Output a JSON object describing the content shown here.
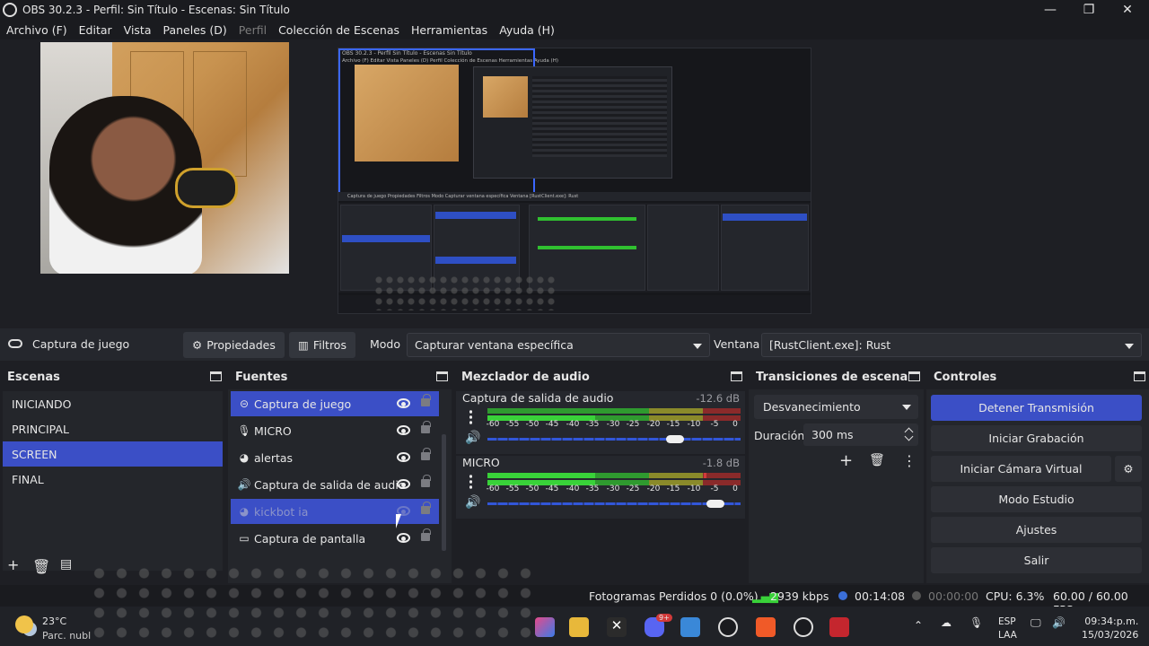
{
  "window": {
    "title": "OBS 30.2.3 - Perfil: Sin Título - Escenas: Sin Título",
    "minimize": "—",
    "maximize": "❐",
    "close": "✕"
  },
  "menu": [
    "Archivo (F)",
    "Editar",
    "Vista",
    "Paneles (D)",
    "Perfil",
    "Colección de Escenas",
    "Herramientas",
    "Ayuda (H)"
  ],
  "menu_disabled_index": 4,
  "nested_preview": {
    "title": "OBS 30.2.3 - Perfil Sin Título - Escenas Sin Título",
    "menu": "Archivo (F)   Editar   Vista   Paneles (D)   Perfil   Colección de Escenas   Herramientas   Ayuda (H)",
    "bar": "Captura de juego     Propiedades     Filtros    Modo   Capturar ventana específica                    Ventana   [RustClient.exe]: Rust"
  },
  "source_toolbar": {
    "source_name": "Captura de juego",
    "properties_label": "Propiedades",
    "filters_label": "Filtros",
    "mode_label": "Modo",
    "mode_value": "Capturar ventana específica",
    "window_label": "Ventana",
    "window_value": "[RustClient.exe]: Rust"
  },
  "scenes": {
    "title": "Escenas",
    "items": [
      "INICIANDO",
      "PRINCIPAL",
      "SCREEN",
      "FINAL"
    ],
    "selected_index": 2
  },
  "sources": {
    "title": "Fuentes",
    "items": [
      {
        "label": "Captura de juego",
        "icon": "gamepad-icon",
        "glyph": "⊝",
        "selected": true
      },
      {
        "label": "MICRO",
        "icon": "microphone-icon",
        "glyph": "🎙",
        "selected": false
      },
      {
        "label": "alertas",
        "icon": "globe-icon",
        "glyph": "◕",
        "selected": false
      },
      {
        "label": "Captura de salida de audio",
        "icon": "speaker-icon",
        "glyph": "🔊",
        "selected": false
      },
      {
        "label": "kickbot ia",
        "icon": "globe-icon",
        "glyph": "◕",
        "selected": true,
        "hidden": true
      },
      {
        "label": "Captura de pantalla",
        "icon": "monitor-icon",
        "glyph": "▭",
        "selected": false
      }
    ]
  },
  "mixer": {
    "title": "Mezclador de audio",
    "scale": [
      "-60",
      "-55",
      "-50",
      "-45",
      "-40",
      "-35",
      "-30",
      "-25",
      "-20",
      "-15",
      "-10",
      "-5",
      "0"
    ],
    "channels": [
      {
        "name": "Captura de salida de audio",
        "db": "-12.6 dB",
        "volume": 0.74
      },
      {
        "name": "MICRO",
        "db": "-1.8 dB",
        "volume": 0.9
      }
    ]
  },
  "transitions": {
    "title": "Transiciones de escena",
    "selected": "Desvanecimiento",
    "duration_label": "Duración",
    "duration_value": "300 ms"
  },
  "controls": {
    "title": "Controles",
    "buttons": [
      "Detener Transmisión",
      "Iniciar Grabación",
      "Iniciar Cámara Virtual",
      "Modo Estudio",
      "Ajustes",
      "Salir"
    ]
  },
  "status": {
    "dropped_frames": "Fotogramas Perdidos 0 (0.0%)",
    "bitrate": "2939 kbps",
    "stream_time": "00:14:08",
    "rec_time": "00:00:00",
    "cpu": "CPU: 6.3%",
    "fps": "60.00 / 60.00 FPS"
  },
  "taskbar": {
    "temperature": "23°C",
    "weather": "Parc. nubl",
    "language_line1": "ESP",
    "language_line2": "LAA",
    "time": "09:34:p.m.",
    "date": "15/03/2026",
    "badge_count": "9+"
  },
  "colors": {
    "accent": "#3b4fc6",
    "meter_green": "#39d239",
    "meter_yellow": "#c9c936",
    "meter_red": "#d23a3a"
  }
}
